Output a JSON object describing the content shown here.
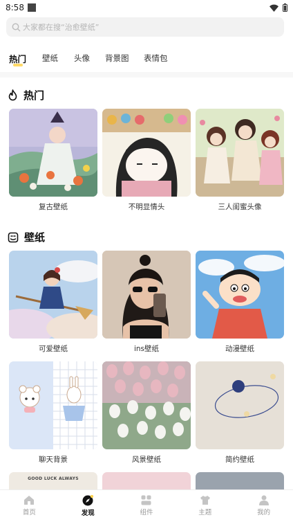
{
  "status_bar": {
    "time": "8:58"
  },
  "search": {
    "placeholder": "大家都在搜“治愈壁纸”"
  },
  "tabs": [
    {
      "label": "热门",
      "active": true
    },
    {
      "label": "壁纸"
    },
    {
      "label": "头像"
    },
    {
      "label": "背景图"
    },
    {
      "label": "表情包"
    }
  ],
  "sections": [
    {
      "title": "热门",
      "icon": "flame-icon",
      "cards": [
        {
          "label": "复古壁纸"
        },
        {
          "label": "不明显情头"
        },
        {
          "label": "三人闺蜜头像"
        }
      ]
    },
    {
      "title": "壁纸",
      "icon": "sticker-icon",
      "cards": [
        {
          "label": "可爱壁纸"
        },
        {
          "label": "ins壁纸"
        },
        {
          "label": "动漫壁纸"
        },
        {
          "label": "聊天背景"
        },
        {
          "label": "风景壁纸"
        },
        {
          "label": "简约壁纸"
        }
      ]
    }
  ],
  "peek_text": "GOOD LUCK ALWAYS",
  "bottom_nav": [
    {
      "label": "首页",
      "icon": "home-icon"
    },
    {
      "label": "发现",
      "icon": "discover-icon",
      "active": true
    },
    {
      "label": "组件",
      "icon": "widgets-icon"
    },
    {
      "label": "主题",
      "icon": "tshirt-icon"
    },
    {
      "label": "我的",
      "icon": "user-icon"
    }
  ],
  "colors": {
    "accent": "#ffd24d",
    "text": "#222222",
    "muted": "#9a9a9a"
  }
}
